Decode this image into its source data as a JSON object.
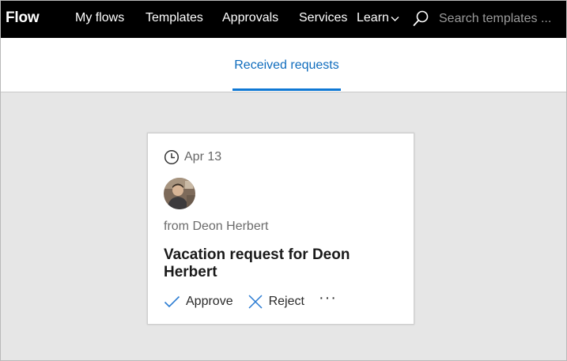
{
  "app": {
    "brand": "Flow"
  },
  "nav": {
    "my_flows": "My flows",
    "templates": "Templates",
    "approvals": "Approvals",
    "services": "Services",
    "learn": "Learn"
  },
  "search": {
    "placeholder": "Search templates ..."
  },
  "tabs": {
    "active_label": "Received requests"
  },
  "request_card": {
    "date": "Apr 13",
    "from": "from Deon Herbert",
    "title": "Vacation request for Deon Herbert",
    "approve_label": "Approve",
    "reject_label": "Reject",
    "more_label": "···"
  },
  "colors": {
    "topbar": "#000000",
    "accent": "#0f6cbd",
    "action_icon": "#2b7cd3",
    "background": "#e6e6e6"
  },
  "icons": [
    "search-icon",
    "chevron-down-icon",
    "clock-icon",
    "checkmark-icon",
    "close-icon",
    "more-icon"
  ]
}
